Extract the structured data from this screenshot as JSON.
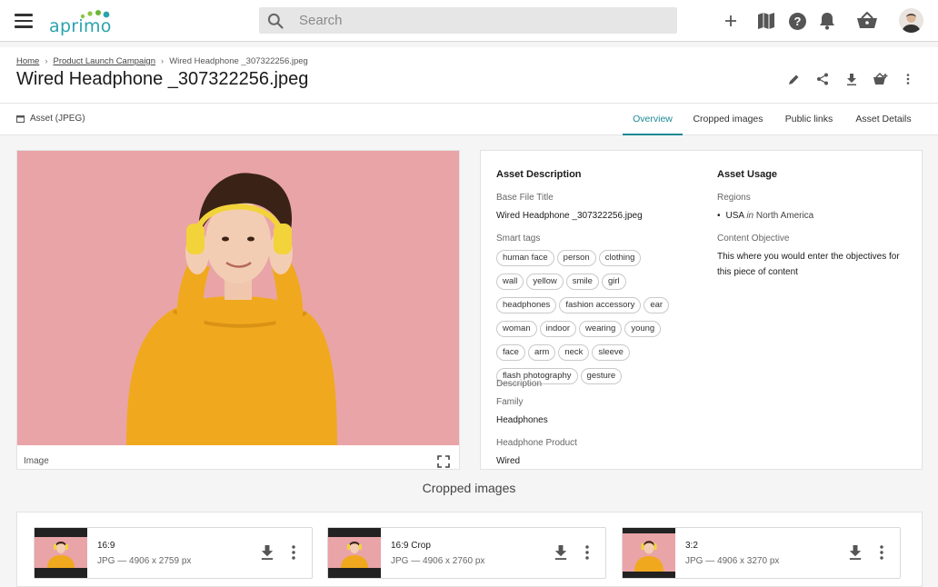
{
  "app": {
    "logo_text": "aprimo"
  },
  "search": {
    "placeholder": "Search"
  },
  "topbar_icons": [
    "add-icon",
    "map-icon",
    "help-icon",
    "bell-icon",
    "basket-icon",
    "avatar"
  ],
  "breadcrumb": {
    "items": [
      "Home",
      "Product Launch Campaign"
    ],
    "current": "Wired Headphone _307322256.jpeg"
  },
  "page_title": "Wired Headphone _307322256.jpeg",
  "header_actions": [
    "edit-icon",
    "share-icon",
    "download-icon",
    "add-to-basket-icon",
    "more-vert-icon"
  ],
  "asset_type": "Asset (JPEG)",
  "tabs": [
    {
      "label": "Overview",
      "active": true
    },
    {
      "label": "Cropped images",
      "active": false
    },
    {
      "label": "Public links",
      "active": false
    },
    {
      "label": "Asset Details",
      "active": false
    }
  ],
  "preview": {
    "caption": "Image"
  },
  "asset_description": {
    "heading": "Asset Description",
    "base_file_title_label": "Base File Title",
    "base_file_title": "Wired Headphone _307322256.jpeg",
    "smart_tags_label": "Smart tags",
    "smart_tags": [
      "human face",
      "person",
      "clothing",
      "wall",
      "yellow",
      "smile",
      "girl",
      "headphones",
      "fashion accessory",
      "ear",
      "woman",
      "indoor",
      "wearing",
      "young",
      "face",
      "arm",
      "neck",
      "sleeve",
      "flash photography",
      "gesture"
    ],
    "description_label": "Description",
    "family_label": "Family",
    "family": "Headphones",
    "headphone_product_label": "Headphone Product",
    "headphone_product": "Wired"
  },
  "asset_usage": {
    "heading": "Asset Usage",
    "regions_label": "Regions",
    "region_name": "USA",
    "region_in": "in",
    "region_parent": "North America",
    "content_objective_label": "Content Objective",
    "content_objective": "This where you would enter the objectives for this piece of content"
  },
  "cropped_images": {
    "title": "Cropped images",
    "items": [
      {
        "name": "16:9",
        "info": "JPG — 4906 x 2759 px"
      },
      {
        "name": "16:9 Crop",
        "info": "JPG — 4906 x 2760 px"
      },
      {
        "name": "3:2",
        "info": "JPG — 4906 x 3270 px"
      }
    ]
  },
  "colors": {
    "accent": "#1c8a94",
    "logo": "#2aa3ad",
    "photo_bg": "#e8a3a7",
    "sweater": "#f0a91e"
  }
}
